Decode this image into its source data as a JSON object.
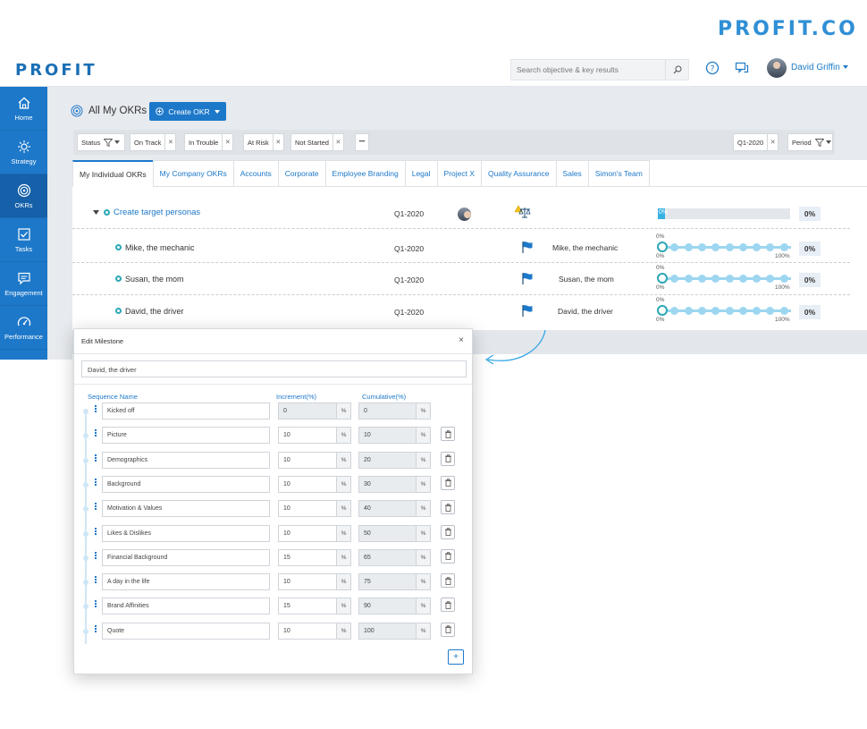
{
  "brand": {
    "top_logo": "PROFIT.CO",
    "app_logo": "PROFIT"
  },
  "header": {
    "search_placeholder": "Search objective & key results",
    "user_name": "David Griffin"
  },
  "sidebar": {
    "items": [
      {
        "label": "Home",
        "icon": "home-icon"
      },
      {
        "label": "Strategy",
        "icon": "sun-icon"
      },
      {
        "label": "OKRs",
        "icon": "target-icon",
        "active": true
      },
      {
        "label": "Tasks",
        "icon": "checkbox-icon"
      },
      {
        "label": "Engagement",
        "icon": "chat-icon"
      },
      {
        "label": "Performance",
        "icon": "gauge-icon"
      }
    ]
  },
  "page": {
    "title": "All My OKRs",
    "create_label": "Create OKR"
  },
  "filters": {
    "status_label": "Status",
    "chips": [
      "On Track",
      "In Trouble",
      "At Risk",
      "Not Started"
    ],
    "more_label": "•••",
    "period_value": "Q1-2020",
    "period_label": "Period"
  },
  "tabs": [
    "My Individual OKRs",
    "My Company OKRs",
    "Accounts",
    "Corporate",
    "Employee Branding",
    "Legal",
    "Project X",
    "Quality Assurance",
    "Sales",
    "Simon's Team"
  ],
  "objective": {
    "name": "Create target personas",
    "period": "Q1-2020",
    "progress": 0,
    "progress_label": "0%",
    "pct_label": "0%"
  },
  "key_results": [
    {
      "name": "Mike, the mechanic",
      "period": "Q1-2020",
      "owner": "Mike, the mechanic",
      "start": "0%",
      "end": "100%",
      "pct": "0%"
    },
    {
      "name": "Susan, the mom",
      "period": "Q1-2020",
      "owner": "Susan, the mom",
      "start": "0%",
      "end": "100%",
      "pct": "0%"
    },
    {
      "name": "David, the driver",
      "period": "Q1-2020",
      "owner": "David, the driver",
      "start": "0%",
      "end": "100%",
      "pct": "0%"
    }
  ],
  "modal": {
    "title": "Edit Milestone",
    "close": "×",
    "milestone_name": "David, the driver",
    "col_sequence": "Sequence Name",
    "col_increment": "Increment(%)",
    "col_cumulative": "Cumulative(%)",
    "unit": "%",
    "add_label": "+",
    "rows": [
      {
        "name": "Kicked off",
        "increment": "0",
        "cumulative": "0"
      },
      {
        "name": "Picture",
        "increment": "10",
        "cumulative": "10"
      },
      {
        "name": "Demographics",
        "increment": "10",
        "cumulative": "20"
      },
      {
        "name": "Background",
        "increment": "10",
        "cumulative": "30"
      },
      {
        "name": "Motivation & Values",
        "increment": "10",
        "cumulative": "40"
      },
      {
        "name": "Likes & Dislikes",
        "increment": "10",
        "cumulative": "50"
      },
      {
        "name": "Financial Background",
        "increment": "15",
        "cumulative": "65"
      },
      {
        "name": "A day in the life",
        "increment": "10",
        "cumulative": "75"
      },
      {
        "name": "Brand Affinities",
        "increment": "15",
        "cumulative": "90"
      },
      {
        "name": "Quote",
        "increment": "10",
        "cumulative": "100"
      }
    ]
  },
  "colors": {
    "primary": "#1d78c9",
    "teal": "#2aa7b5",
    "progress": "#37b1e3"
  }
}
